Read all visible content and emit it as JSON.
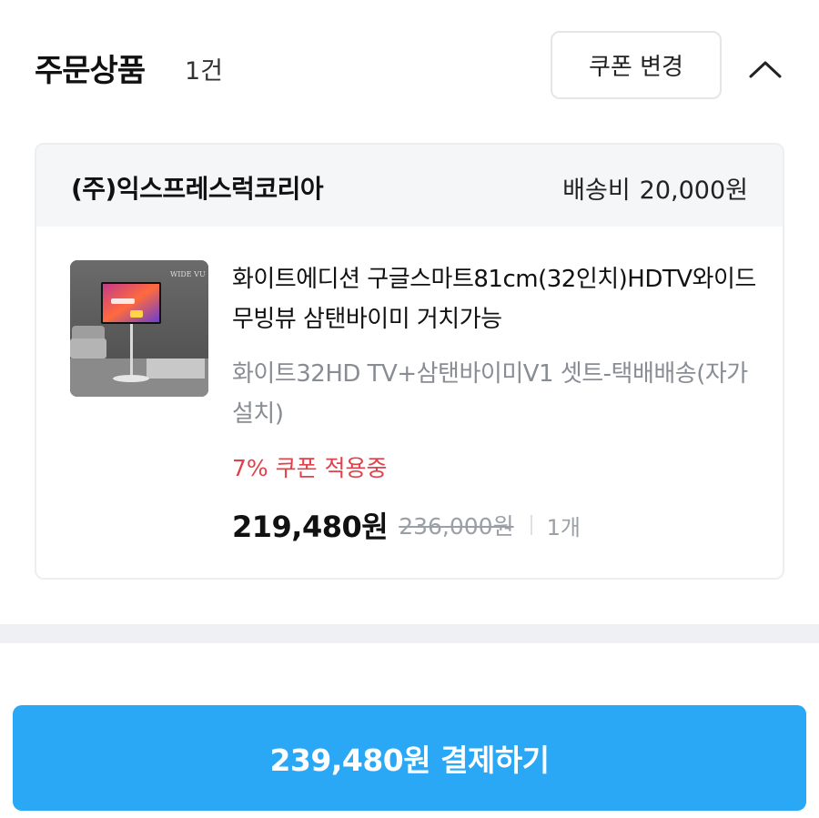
{
  "header": {
    "title": "주문상품",
    "count": "1건",
    "coupon_change_label": "쿠폰 변경"
  },
  "seller": {
    "name": "(주)익스프레스럭코리아",
    "shipping_label": "배송비",
    "shipping_fee": "20,000원"
  },
  "product": {
    "thumbnail_brand": "WIDE VU",
    "name": "화이트에디션 구글스마트81cm(32인치)HDTV와이드무빙뷰 삼탠바이미 거치가능",
    "option": "화이트32HD TV+삼탠바이미V1 셋트-택배배송(자가설치)",
    "coupon_applied": "7% 쿠폰 적용중",
    "price": "219,480원",
    "original_price": "236,000원",
    "quantity": "1개"
  },
  "footer": {
    "pay_button_label": "239,480원 결제하기"
  },
  "colors": {
    "accent_blue": "#2ba8f5",
    "coupon_red": "#e0414a",
    "muted_gray": "#888c93"
  }
}
